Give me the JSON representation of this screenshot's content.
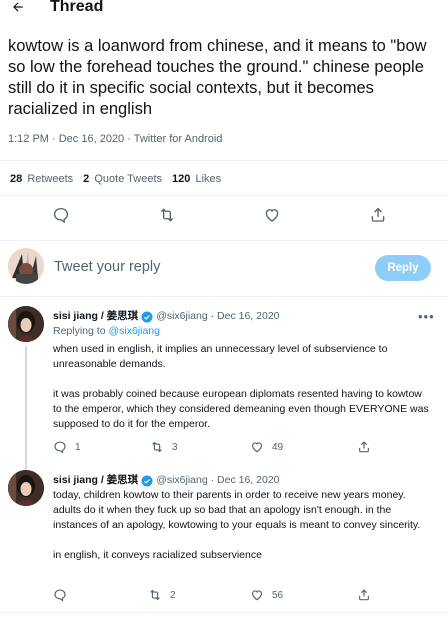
{
  "header": {
    "title": "Thread"
  },
  "main_tweet": {
    "text": "kowtow is a loanword from chinese, and it means to \"bow so low the forehead touches the ground.\" chinese people still do it in specific social contexts, but it becomes racialized in english",
    "meta": "1:12 PM · Dec 16, 2020 · Twitter for Android",
    "stats": {
      "retweets_count": "28",
      "retweets_label": "Retweets",
      "quotes_count": "2",
      "quotes_label": "Quote Tweets",
      "likes_count": "120",
      "likes_label": "Likes"
    }
  },
  "reply_box": {
    "placeholder": "Tweet your reply",
    "button_label": "Reply"
  },
  "replies": [
    {
      "name": "sisi jiang / 姜思琪",
      "handle_date": "@six6jiang · Dec 16, 2020",
      "replying_prefix": "Replying to",
      "replying_handle": "@six6jiang",
      "paragraphs": [
        "when used in english, it implies an unnecessary level of subservience to unreasonable demands.",
        "it was probably coined because european diplomats resented having to kowtow to the emperor, which they considered demeaning even though EVERYONE was supposed to do it for the emperor."
      ],
      "replies": "1",
      "retweets": "3",
      "likes": "49"
    },
    {
      "name": "sisi jiang / 姜思琪",
      "handle_date": "@six6jiang · Dec 16, 2020",
      "paragraphs": [
        "today, children kowtow to their parents in order to receive new years money. adults do it when they fuck up so bad that an apology isn't enough. in the instances of an apology, kowtowing to your equals is meant to convey sincerity.",
        "in english, it conveys racialized subservience"
      ],
      "replies": "",
      "retweets": "2",
      "likes": "56"
    }
  ],
  "colors": {
    "accent": "#1d9bf0",
    "muted": "#536471",
    "text": "#0f1419",
    "reply_button": "#8ecdf7"
  }
}
